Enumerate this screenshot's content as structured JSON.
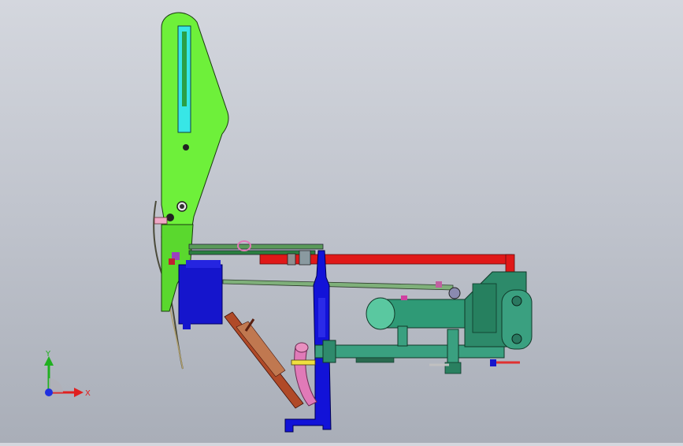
{
  "triad": {
    "x_label": "X",
    "y_label": "Y",
    "x_color": "#e02020",
    "y_color": "#20b020",
    "z_color": "#2030e0"
  },
  "parts": {
    "arm_color": "#6ef03a",
    "slot_color": "#37e6e6",
    "base_frame_color": "#1010e0",
    "rail_color": "#e01818",
    "motor_color": "#3aa080",
    "pink_color": "#e07ab8",
    "brown_link_color": "#b04a28"
  }
}
